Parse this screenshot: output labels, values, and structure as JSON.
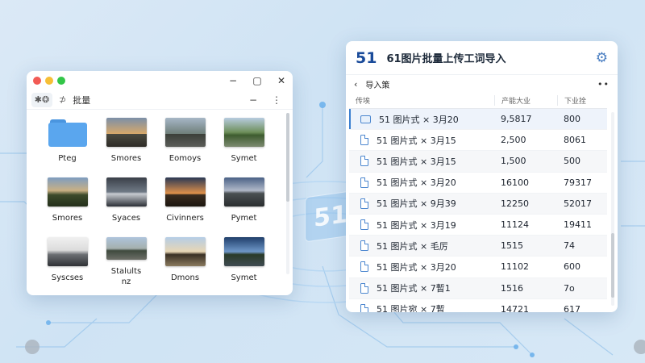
{
  "background": {
    "badge_text": "51"
  },
  "left_window": {
    "toolbar": {
      "icon_left": "✱❂",
      "pin": "⊅",
      "label": "批量",
      "minimize": "−",
      "more": "⋮"
    },
    "window_controls": {
      "minimize": "−",
      "maximize": "▢",
      "close": "✕"
    },
    "items": [
      {
        "label": "Pteg",
        "kind": "folder"
      },
      {
        "label": "Smores",
        "kind": "image"
      },
      {
        "label": "Eomoys",
        "kind": "image"
      },
      {
        "label": "Symet",
        "kind": "image"
      },
      {
        "label": "Smores",
        "kind": "image"
      },
      {
        "label": "Syaces",
        "kind": "image"
      },
      {
        "label": "Civinners",
        "kind": "image"
      },
      {
        "label": "Pymet",
        "kind": "image"
      },
      {
        "label": "Syscses",
        "kind": "device"
      },
      {
        "label": "Stalults\nnz",
        "kind": "image"
      },
      {
        "label": "Dmons",
        "kind": "image"
      },
      {
        "label": "Symet",
        "kind": "image"
      }
    ]
  },
  "right_window": {
    "logo": "51",
    "title": "61图片批量上传工词导入",
    "subheader": {
      "back": "‹",
      "label": "导入策",
      "more": "••"
    },
    "columns": {
      "name": "传埃",
      "size": "产能大业",
      "speed": "下业拴"
    },
    "rows": [
      {
        "name": "51 图片式 × 3月20",
        "size": "9,5817",
        "speed": "800",
        "icon": "folder",
        "selected": true
      },
      {
        "name": "51 图片式 × 3月15",
        "size": "2,500",
        "speed": "8061",
        "icon": "file"
      },
      {
        "name": "51 图片式 × 3月15",
        "size": "1,500",
        "speed": "500",
        "icon": "file"
      },
      {
        "name": "51 图片式 × 3月20",
        "size": "16100",
        "speed": "79317",
        "icon": "file"
      },
      {
        "name": "51 图片式 × 9月39",
        "size": "12250",
        "speed": "52017",
        "icon": "file"
      },
      {
        "name": "51 图片式 × 3月19",
        "size": "11124",
        "speed": "19411",
        "icon": "file"
      },
      {
        "name": "51 图片式 × 毛厉",
        "size": "1515",
        "speed": "74",
        "icon": "file"
      },
      {
        "name": "51 图片式 × 3月20",
        "size": "11102",
        "speed": "600",
        "icon": "file"
      },
      {
        "name": "51 图片式 × 7暫1",
        "size": "1516",
        "speed": "7o",
        "icon": "file"
      },
      {
        "name": "51 图片宛 × 7暫",
        "size": "14721",
        "speed": "617",
        "icon": "file"
      }
    ]
  },
  "colors": {
    "accent": "#3b7fd0",
    "logo": "#1a4b9a",
    "folder": "#5aa6ee"
  }
}
